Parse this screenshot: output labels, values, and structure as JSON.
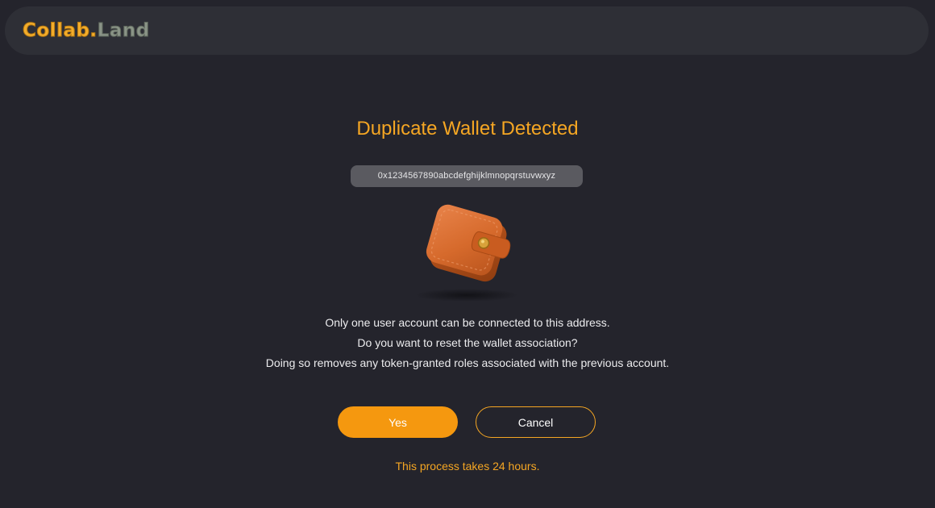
{
  "header": {
    "logo_part1": "Collab.",
    "logo_part2": "Land"
  },
  "dialog": {
    "title": "Duplicate Wallet Detected",
    "wallet_address": "0x1234567890abcdefghijklmnopqrstuvwxyz",
    "wallet_icon": "wallet-icon",
    "message_lines": [
      "Only one user account can be connected to this address.",
      "Do you want to reset the wallet association?",
      "Doing so removes any token-granted roles associated with the previous account."
    ],
    "yes_label": "Yes",
    "cancel_label": "Cancel",
    "note": "This process takes 24 hours."
  },
  "colors": {
    "background": "#24242c",
    "header": "#2e2f36",
    "accent": "#f5a623",
    "primary_button": "#f5980f"
  }
}
